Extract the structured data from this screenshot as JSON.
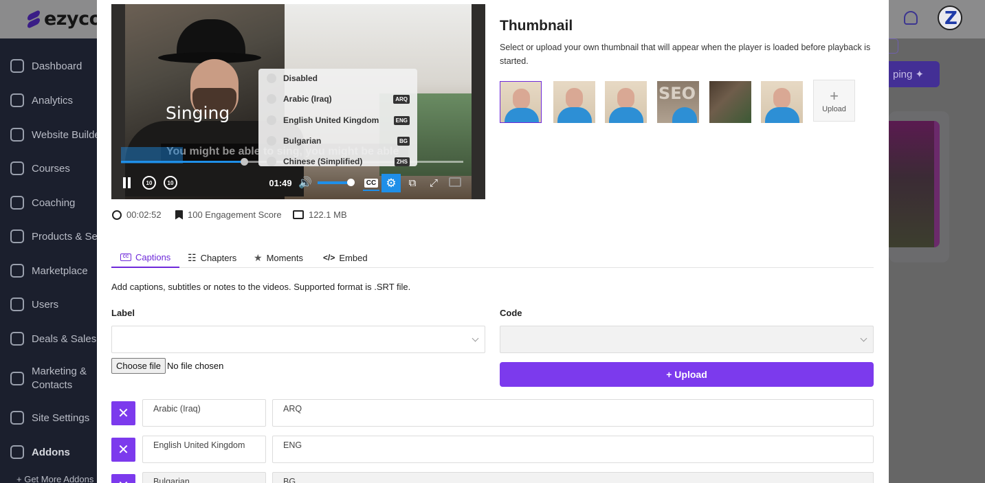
{
  "app": {
    "logo_text": "ezycou"
  },
  "sidebar": {
    "items": [
      {
        "label": "Dashboard"
      },
      {
        "label": "Analytics"
      },
      {
        "label": "Website Builder"
      },
      {
        "label": "Courses"
      },
      {
        "label": "Coaching"
      },
      {
        "label": "Products & Services"
      },
      {
        "label": "Marketplace"
      },
      {
        "label": "Users"
      },
      {
        "label": "Deals & Sales"
      },
      {
        "label": "Marketing & Contacts"
      },
      {
        "label": "Site Settings"
      },
      {
        "label": "Addons"
      },
      {
        "label": "+ Get More Addons"
      }
    ]
  },
  "background": {
    "purple_button_label": "ping ✦"
  },
  "player": {
    "overlay_title": "Singing",
    "caption_text": "You might be able to sing, you might be able",
    "current_time": "01:49",
    "seek_back_label": "10",
    "seek_forward_label": "10",
    "cc_label": "CC",
    "progress_fraction": 0.36,
    "volume_fraction": 0.92,
    "caption_menu": [
      {
        "label": "Disabled",
        "code": ""
      },
      {
        "label": "Arabic (Iraq)",
        "code": "ARQ"
      },
      {
        "label": "English United Kingdom",
        "code": "ENG"
      },
      {
        "label": "Bulgarian",
        "code": "BG"
      },
      {
        "label": "Chinese (Simplified)",
        "code": "ZHS"
      }
    ]
  },
  "video_meta": {
    "duration": "00:02:52",
    "engagement": "100 Engagement Score",
    "size": "122.1 MB"
  },
  "thumbnail": {
    "title": "Thumbnail",
    "description": "Select or upload your own thumbnail that will appear when the player is loaded before playback is started.",
    "seo_text": "SEO",
    "upload_label": "Upload",
    "selected_index": 0
  },
  "tabs": [
    {
      "label": "Captions",
      "icon": "cc-icon"
    },
    {
      "label": "Chapters",
      "icon": "list-icon"
    },
    {
      "label": "Moments",
      "icon": "star-icon"
    },
    {
      "label": "Embed",
      "icon": "code-icon"
    }
  ],
  "captions": {
    "description": "Add captions, subtitles or notes to the videos. Supported format is .SRT file.",
    "label_field": "Label",
    "code_field": "Code",
    "choose_file_label": "Choose file",
    "file_status": "No file chosen",
    "upload_button": "+ Upload",
    "list": [
      {
        "label": "Arabic (Iraq)",
        "code": "ARQ"
      },
      {
        "label": "English United Kingdom",
        "code": "ENG"
      },
      {
        "label": "Bulgarian",
        "code": "BG"
      }
    ]
  },
  "colors": {
    "accent": "#7c3aed",
    "player_accent": "#1f8fe8"
  }
}
